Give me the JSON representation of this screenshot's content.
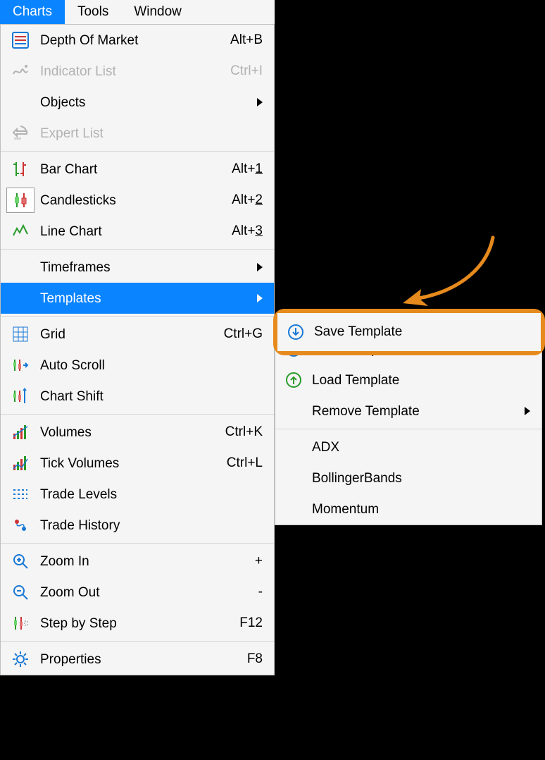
{
  "menubar": {
    "items": [
      {
        "id": "charts",
        "label": "Charts",
        "active": true
      },
      {
        "id": "tools",
        "label": "Tools",
        "active": false
      },
      {
        "id": "window",
        "label": "Window",
        "active": false
      }
    ]
  },
  "charts_menu": {
    "groups": [
      {
        "items": [
          {
            "id": "depth-of-market",
            "label": "Depth Of Market",
            "shortcut": "Alt+B",
            "icon": "depth-icon"
          },
          {
            "id": "indicator-list",
            "label": "Indicator List",
            "shortcut": "Ctrl+I",
            "icon": "indicator-list-icon",
            "disabled": true
          },
          {
            "id": "objects",
            "label": "Objects",
            "submenu": true
          },
          {
            "id": "expert-list",
            "label": "Expert List",
            "icon": "expert-list-icon",
            "disabled": true
          }
        ]
      },
      {
        "items": [
          {
            "id": "bar-chart",
            "label": "Bar Chart",
            "shortcut_prefix": "Alt+",
            "shortcut_key": "1",
            "icon": "bar-chart-icon"
          },
          {
            "id": "candlesticks",
            "label": "Candlesticks",
            "shortcut_prefix": "Alt+",
            "shortcut_key": "2",
            "icon": "candlestick-icon",
            "active_frame": true
          },
          {
            "id": "line-chart",
            "label": "Line Chart",
            "shortcut_prefix": "Alt+",
            "shortcut_key": "3",
            "icon": "line-chart-icon"
          }
        ]
      },
      {
        "items": [
          {
            "id": "timeframes",
            "label": "Timeframes",
            "submenu": true
          },
          {
            "id": "templates",
            "label": "Templates",
            "submenu": true,
            "highlight": true
          }
        ]
      },
      {
        "items": [
          {
            "id": "grid",
            "label": "Grid",
            "shortcut": "Ctrl+G",
            "icon": "grid-icon"
          },
          {
            "id": "auto-scroll",
            "label": "Auto Scroll",
            "icon": "auto-scroll-icon"
          },
          {
            "id": "chart-shift",
            "label": "Chart Shift",
            "icon": "chart-shift-icon"
          }
        ]
      },
      {
        "items": [
          {
            "id": "volumes",
            "label": "Volumes",
            "shortcut": "Ctrl+K",
            "icon": "volumes-icon"
          },
          {
            "id": "tick-volumes",
            "label": "Tick Volumes",
            "shortcut": "Ctrl+L",
            "icon": "tick-volumes-icon"
          },
          {
            "id": "trade-levels",
            "label": "Trade Levels",
            "icon": "trade-levels-icon"
          },
          {
            "id": "trade-history",
            "label": "Trade History",
            "icon": "trade-history-icon"
          }
        ]
      },
      {
        "items": [
          {
            "id": "zoom-in",
            "label": "Zoom In",
            "shortcut": "+",
            "icon": "zoom-in-icon"
          },
          {
            "id": "zoom-out",
            "label": "Zoom Out",
            "shortcut": "-",
            "icon": "zoom-out-icon"
          },
          {
            "id": "step",
            "label": "Step by Step",
            "shortcut": "F12",
            "icon": "step-icon"
          }
        ]
      },
      {
        "items": [
          {
            "id": "properties",
            "label": "Properties",
            "shortcut": "F8",
            "icon": "properties-icon"
          }
        ]
      }
    ]
  },
  "templates_menu": {
    "groups": [
      {
        "items": [
          {
            "id": "save-template",
            "label": "Save Template",
            "icon": "save-template-icon",
            "callout": true
          },
          {
            "id": "load-template",
            "label": "Load Template",
            "icon": "load-template-icon"
          },
          {
            "id": "remove-template",
            "label": "Remove Template",
            "submenu": true
          }
        ]
      },
      {
        "items": [
          {
            "id": "tpl-adx",
            "label": "ADX"
          },
          {
            "id": "tpl-bollinger",
            "label": "BollingerBands"
          },
          {
            "id": "tpl-momentum",
            "label": "Momentum"
          }
        ]
      }
    ]
  },
  "annotation": {
    "arrow_color": "#e78a1d"
  }
}
